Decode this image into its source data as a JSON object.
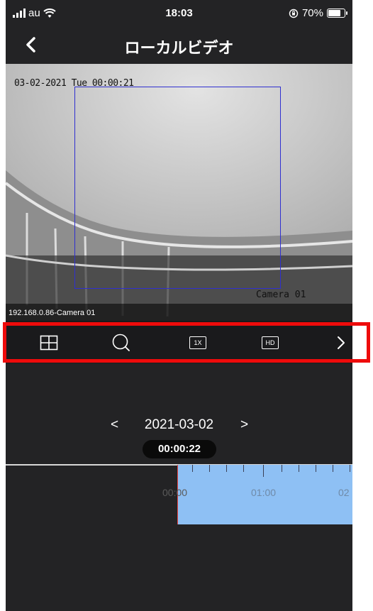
{
  "status_bar": {
    "carrier": "au",
    "time": "18:03",
    "battery_text": "70%",
    "battery_level": 0.7
  },
  "nav": {
    "title": "ローカルビデオ",
    "back_icon": "chevron-left-icon"
  },
  "video": {
    "timestamp": "03-02-2021 Tue 00:00:21",
    "camera_label": "Camera 01",
    "source_label": "192.168.0.86-Camera 01",
    "roi_color": "#2f2fd0"
  },
  "toolbar": {
    "buttons": [
      {
        "name": "layout-grid-button",
        "icon": "grid-icon"
      },
      {
        "name": "zoom-button",
        "icon": "search-icon"
      },
      {
        "name": "speed-button",
        "icon": "speed-icon",
        "label": "1X"
      },
      {
        "name": "quality-button",
        "icon": "hd-icon",
        "label": "HD"
      },
      {
        "name": "more-button",
        "icon": "chevron-right-icon"
      }
    ],
    "highlight_color": "#ee0b0b"
  },
  "playback": {
    "prev_label": "<",
    "date": "2021-03-02",
    "next_label": ">",
    "current_time": "00:00:22",
    "timeline": {
      "labels": [
        "00:00",
        "01:00",
        "02"
      ],
      "recording_color": "#8ec0f4",
      "cursor_color": "#e24444"
    }
  }
}
